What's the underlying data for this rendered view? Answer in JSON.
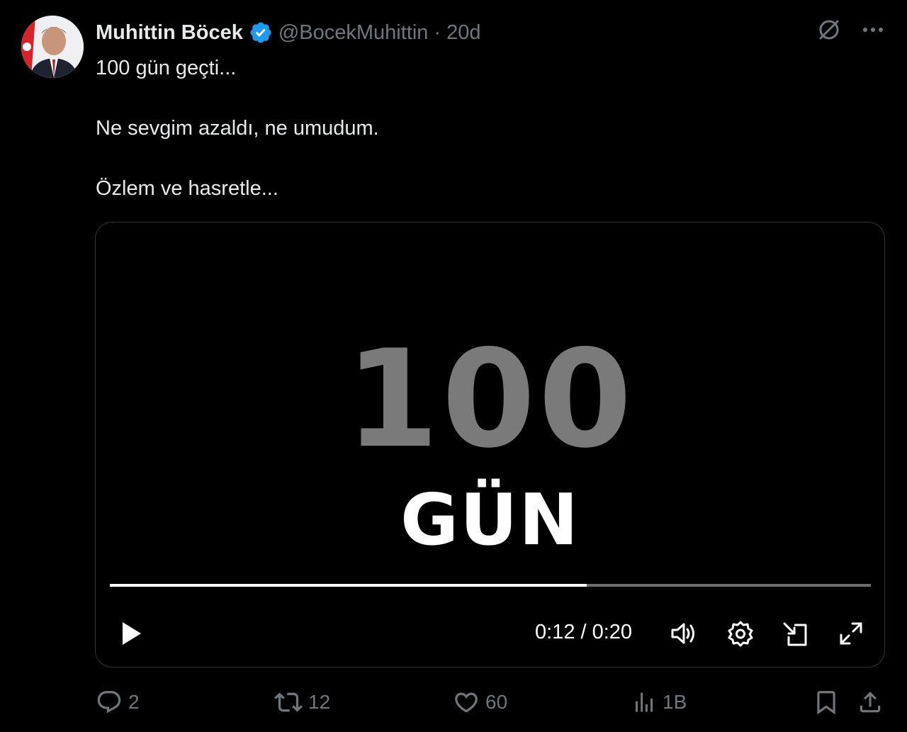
{
  "author": {
    "display_name": "Muhittin Böcek",
    "handle": "@BocekMuhittin",
    "separator": "·",
    "time": "20d"
  },
  "tweet": {
    "lines": [
      "100 gün geçti...",
      "Ne sevgim azaldı, ne umudum.",
      "Özlem ve hasretle..."
    ]
  },
  "video": {
    "big_number": "100",
    "big_word": "GÜN",
    "time_readout": "0:12 / 0:20",
    "progress": 0.627
  },
  "actions": {
    "replies": "2",
    "reposts": "12",
    "likes": "60",
    "views": "1B"
  },
  "colors": {
    "background": "#000000",
    "text": "#e7e9ea",
    "muted": "#71767b",
    "verified": "#1d9bf0",
    "border": "#2f3336"
  }
}
